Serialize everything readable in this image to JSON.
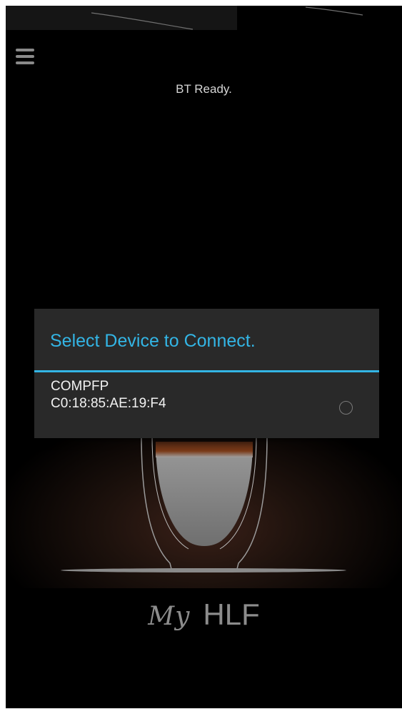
{
  "status": {
    "text": "BT Ready."
  },
  "brand": {
    "script": "My",
    "name": "HLF"
  },
  "dialog": {
    "title": "Select Device to Connect.",
    "devices": [
      {
        "name": "COMPFP",
        "address": "C0:18:85:AE:19:F4",
        "selected": false
      }
    ]
  },
  "colors": {
    "accent": "#33b5e5",
    "background": "#000000",
    "dialog": "#292929"
  },
  "icons": {
    "menu": "hamburger-menu-icon",
    "radio": "radio-unchecked-icon"
  }
}
